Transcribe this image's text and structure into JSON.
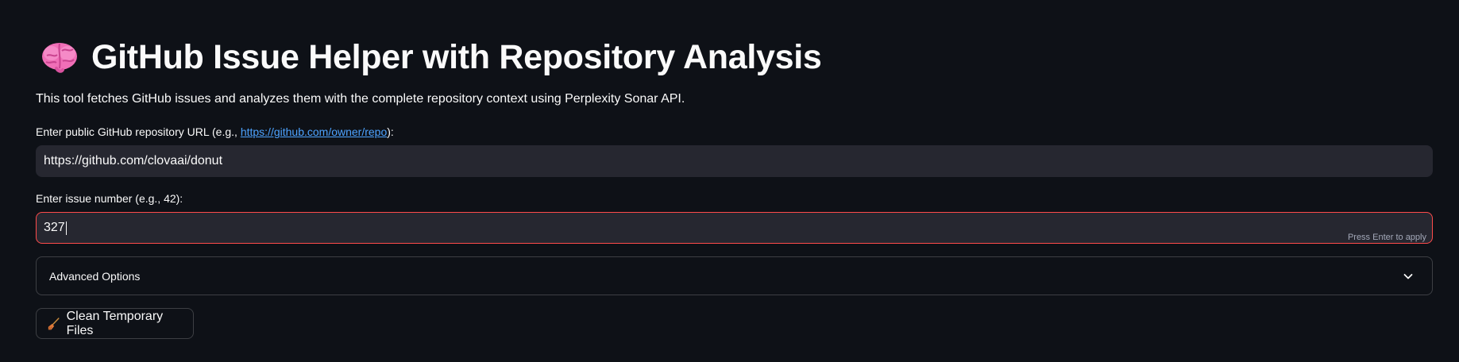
{
  "header": {
    "icon": "brain-icon",
    "title": "GitHub Issue Helper with Repository Analysis"
  },
  "description": "This tool fetches GitHub issues and analyzes them with the complete repository context using Perplexity Sonar API.",
  "repo_field": {
    "label_prefix": "Enter public GitHub repository URL (e.g., ",
    "label_link": "https://github.com/owner/repo",
    "label_suffix": "):",
    "value": "https://github.com/clovaai/donut"
  },
  "issue_field": {
    "label": "Enter issue number (e.g., 42):",
    "value": "327",
    "hint": "Press Enter to apply",
    "focus_color": "#ff4b4b"
  },
  "advanced_options": {
    "label": "Advanced Options",
    "icon": "chevron-down-icon",
    "expanded": false
  },
  "clean_button": {
    "icon": "broom-icon",
    "label": "Clean Temporary Files"
  },
  "colors": {
    "background": "#0e1117",
    "input_background": "#262730",
    "link": "#4da3ff",
    "text": "#fafafa"
  }
}
